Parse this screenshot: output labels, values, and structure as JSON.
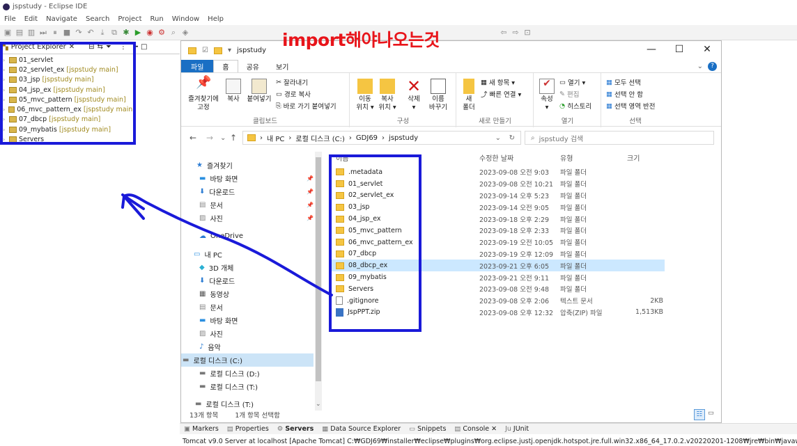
{
  "eclipse": {
    "title": "jspstudy - Eclipse IDE",
    "menu": [
      "File",
      "Edit",
      "Navigate",
      "Search",
      "Project",
      "Run",
      "Window",
      "Help"
    ],
    "project_explorer": {
      "title": "Project Explorer",
      "items": [
        {
          "name": "01_servlet",
          "sub": ""
        },
        {
          "name": "02_servlet_ex",
          "sub": "[jspstudy main]"
        },
        {
          "name": "03_jsp",
          "sub": "[jspstudy main]"
        },
        {
          "name": "04_jsp_ex",
          "sub": "[jspstudy main]"
        },
        {
          "name": "05_mvc_pattern",
          "sub": "[jspstudy main]"
        },
        {
          "name": "06_mvc_pattern_ex",
          "sub": "[jspstudy main]"
        },
        {
          "name": "07_dbcp",
          "sub": "[jspstudy main]"
        },
        {
          "name": "09_mybatis",
          "sub": "[jspstudy main]"
        },
        {
          "name": "Servers",
          "sub": ""
        }
      ]
    },
    "bottom_tabs": [
      "Markers",
      "Properties",
      "Servers",
      "Data Source Explorer",
      "Snippets",
      "Console",
      "JUnit"
    ],
    "console_line": "Tomcat v9.0 Server at localhost [Apache Tomcat] C:₩GDJ69₩installer₩eclipse₩plugins₩org.eclipse.justj.openjdk.hotspot.jre.full.win32.x86_64_17.0.2.v20220201-1208₩jre₩bin₩javaw.exe  (2023. 9. 21. 오후"
  },
  "annotation": {
    "text": "import해야나오는것",
    "color": "#e8141a",
    "box_color": "#1a1ad9"
  },
  "explorer": {
    "title": "jspstudy",
    "tabs": {
      "file": "파일",
      "home": "홈",
      "share": "공유",
      "view": "보기"
    },
    "ribbon": {
      "pin": "즐겨찾기에\n고정",
      "copy": "복사",
      "paste": "붙여넣기",
      "cut": "잘라내기",
      "copy_path": "경로 복사",
      "paste_shortcut": "바로 가기 붙여넣기",
      "clipboard": "클립보드",
      "move_to": "이동\n위치 ▾",
      "copy_to": "복사\n위치 ▾",
      "delete": "삭제\n▾",
      "rename": "이름\n바꾸기",
      "organize": "구성",
      "new_folder": "새\n폴더",
      "new_item": "새 항목 ▾",
      "easy_access": "빠른 연결 ▾",
      "new": "새로 만들기",
      "properties": "속성\n▾",
      "open": "열기 ▾",
      "edit": "편집",
      "history": "히스토리",
      "open_group": "열기",
      "select_all": "모두 선택",
      "select_none": "선택 안 함",
      "invert": "선택 영역 반전",
      "select": "선택"
    },
    "address": [
      "내 PC",
      "로컬 디스크 (C:)",
      "GDJ69",
      "jspstudy"
    ],
    "search_placeholder": "jspstudy 검색",
    "nav": [
      {
        "label": "즐겨찾기",
        "icon": "star-icon",
        "color": "#2a7bd3"
      },
      {
        "label": "바탕 화면",
        "icon": "desktop-icon",
        "color": "#2a8fe0",
        "pin": true
      },
      {
        "label": "다운로드",
        "icon": "download-icon",
        "color": "#2a7bd3",
        "pin": true
      },
      {
        "label": "문서",
        "icon": "document-icon",
        "color": "#888",
        "pin": true
      },
      {
        "label": "사진",
        "icon": "picture-icon",
        "color": "#888",
        "pin": true
      },
      {
        "label": "OneDrive",
        "icon": "cloud-icon",
        "color": "#2a7bd3"
      },
      {
        "label": "내 PC",
        "icon": "pc-icon",
        "color": "#2a8fe0"
      },
      {
        "label": "3D 개체",
        "icon": "cube-icon",
        "color": "#2ab0d3"
      },
      {
        "label": "다운로드",
        "icon": "download-icon",
        "color": "#2a7bd3"
      },
      {
        "label": "동영상",
        "icon": "video-icon",
        "color": "#555"
      },
      {
        "label": "문서",
        "icon": "document-icon",
        "color": "#888"
      },
      {
        "label": "바탕 화면",
        "icon": "desktop-icon",
        "color": "#2a8fe0"
      },
      {
        "label": "사진",
        "icon": "picture-icon",
        "color": "#888"
      },
      {
        "label": "음악",
        "icon": "music-icon",
        "color": "#2a7bd3"
      },
      {
        "label": "로컬 디스크 (C:)",
        "icon": "disk-icon",
        "color": "#777",
        "selected": true
      },
      {
        "label": "로컬 디스크 (D:)",
        "icon": "disk-icon",
        "color": "#777"
      },
      {
        "label": "로컬 디스크 (T:)",
        "icon": "disk-icon",
        "color": "#777"
      },
      {
        "label": "로컬 디스크 (T:)",
        "icon": "disk-icon",
        "color": "#777"
      }
    ],
    "columns": {
      "name": "이름",
      "date": "수정한 날짜",
      "type": "유형",
      "size": "크기"
    },
    "files": [
      {
        "name": ".metadata",
        "date": "2023-09-08 오전 9:03",
        "type": "파일 폴더",
        "size": "",
        "kind": "folder"
      },
      {
        "name": "01_servlet",
        "date": "2023-09-08 오전 10:21",
        "type": "파일 폴더",
        "size": "",
        "kind": "folder"
      },
      {
        "name": "02_servlet_ex",
        "date": "2023-09-14 오후 5:23",
        "type": "파일 폴더",
        "size": "",
        "kind": "folder"
      },
      {
        "name": "03_jsp",
        "date": "2023-09-14 오전 9:05",
        "type": "파일 폴더",
        "size": "",
        "kind": "folder"
      },
      {
        "name": "04_jsp_ex",
        "date": "2023-09-18 오후 2:29",
        "type": "파일 폴더",
        "size": "",
        "kind": "folder"
      },
      {
        "name": "05_mvc_pattern",
        "date": "2023-09-18 오후 2:33",
        "type": "파일 폴더",
        "size": "",
        "kind": "folder"
      },
      {
        "name": "06_mvc_pattern_ex",
        "date": "2023-09-19 오전 10:05",
        "type": "파일 폴더",
        "size": "",
        "kind": "folder"
      },
      {
        "name": "07_dbcp",
        "date": "2023-09-19 오후 12:09",
        "type": "파일 폴더",
        "size": "",
        "kind": "folder"
      },
      {
        "name": "08_dbcp_ex",
        "date": "2023-09-21 오후 6:05",
        "type": "파일 폴더",
        "size": "",
        "kind": "folder",
        "selected": true
      },
      {
        "name": "09_mybatis",
        "date": "2023-09-21 오전 9:11",
        "type": "파일 폴더",
        "size": "",
        "kind": "folder"
      },
      {
        "name": "Servers",
        "date": "2023-09-08 오전 9:48",
        "type": "파일 폴더",
        "size": "",
        "kind": "folder"
      },
      {
        "name": ".gitignore",
        "date": "2023-09-08 오후 2:06",
        "type": "텍스트 문서",
        "size": "2KB",
        "kind": "doc"
      },
      {
        "name": "JspPPT.zip",
        "date": "2023-09-08 오후 12:32",
        "type": "압축(ZIP) 파일",
        "size": "1,513KB",
        "kind": "zip"
      }
    ],
    "status": {
      "count": "13개 항목",
      "selected": "1개 항목 선택함"
    }
  }
}
